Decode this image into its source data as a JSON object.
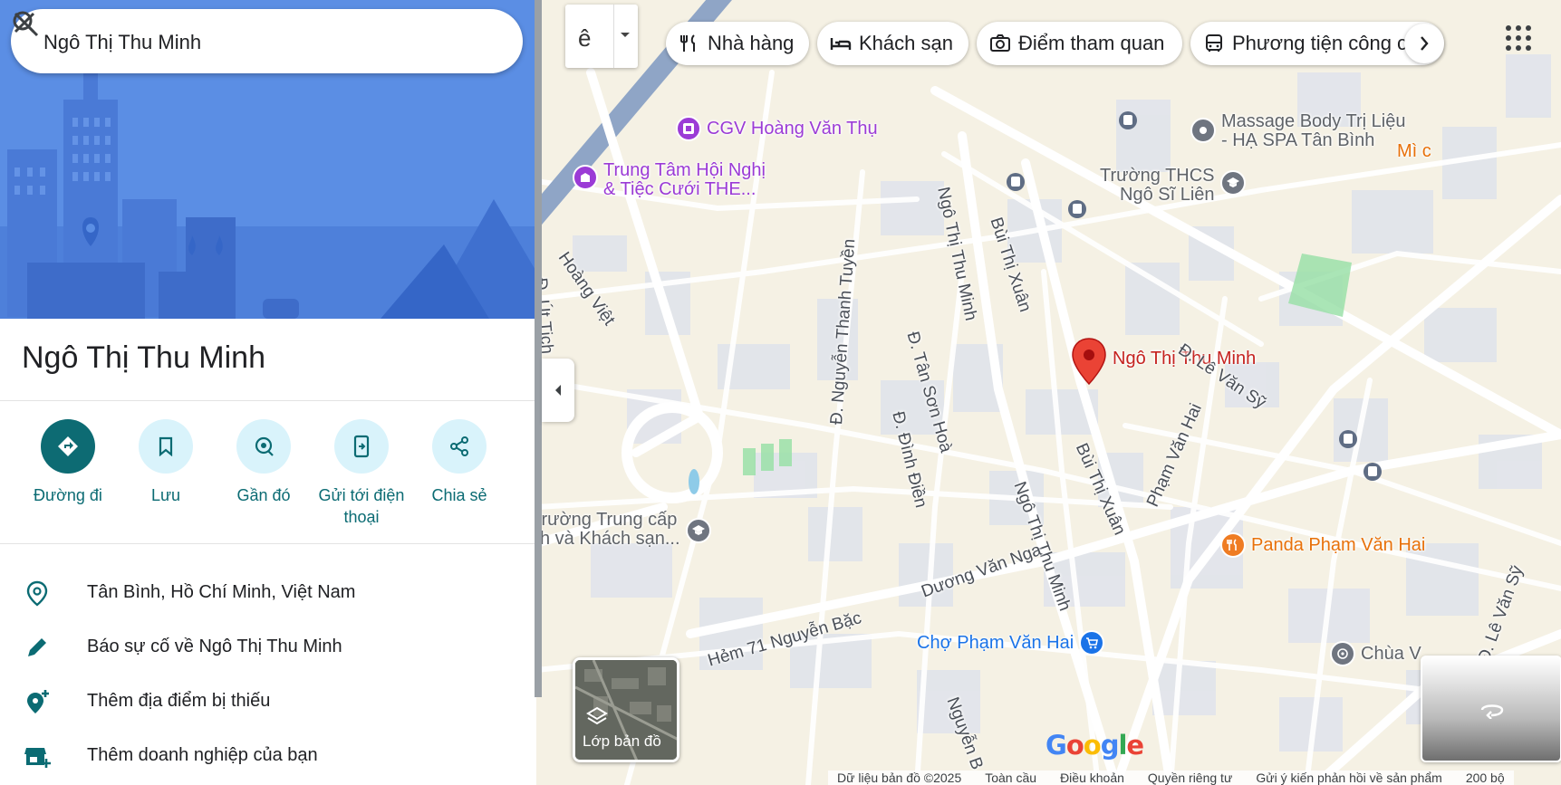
{
  "search": {
    "value": "Ngô Thị Thu Minh"
  },
  "place": {
    "title": "Ngô Thị Thu Minh"
  },
  "actions": [
    {
      "label": "Đường đi",
      "icon": "directions-icon"
    },
    {
      "label": "Lưu",
      "icon": "bookmark-icon"
    },
    {
      "label": "Gần đó",
      "icon": "nearby-icon"
    },
    {
      "label": "Gửi tới điện thoại",
      "icon": "send-to-phone-icon"
    },
    {
      "label": "Chia sẻ",
      "icon": "share-icon"
    }
  ],
  "info": {
    "address": "Tân Bình, Hồ Chí Minh, Việt Nam",
    "report": "Báo sự cố về Ngô Thị Thu Minh",
    "add_place": "Thêm địa điểm bị thiếu",
    "add_business": "Thêm doanh nghiệp của bạn"
  },
  "ime": {
    "letter": "ê"
  },
  "chips": [
    {
      "label": "Nhà hàng",
      "icon": "fork-knife-icon"
    },
    {
      "label": "Khách sạn",
      "icon": "bed-icon"
    },
    {
      "label": "Điểm tham quan",
      "icon": "camera-icon"
    },
    {
      "label": "Phương tiện công c",
      "icon": "bus-icon"
    }
  ],
  "pois": {
    "cgv": "CGV Hoàng Văn Thụ",
    "trungtam_1": "Trung Tâm Hội Nghị",
    "trungtam_2": "& Tiệc Cưới THE...",
    "massage_1": "Massage Body Trị Liệu",
    "massage_2": "- HẠ SPA Tân Bình",
    "mi": "Mì c",
    "truong_thcs_1": "Trường THCS",
    "truong_thcs_2": "Ngô Sĩ Liên",
    "pin": "Ngô Thị Thu Minh",
    "truong_tc_1": "Trường Trung cấp",
    "truong_tc_2": "ch và Khách sạn...",
    "panda": "Panda Phạm Văn Hai",
    "cho": "Chợ Phạm Văn Hai",
    "chua": "Chùa V"
  },
  "streets": {
    "hoang_viet": "Hoàng Việt",
    "ut_tich": "Đ. Út Tịch",
    "nguyen_thanh_tuyen": "Đ. Nguyễn Thanh Tuyền",
    "ngo_thi_thu_minh_top": "Ngô Thị Thu Minh",
    "bui_thi_xuan_top": "Bùi Thị Xuân",
    "tan_son_hoa": "Đ. Tân Sơn Hoà",
    "dinh_dien": "Đ. Đình Điền",
    "le_van_sy": "Đ. Lê Văn Sỹ",
    "pham_van_hai": "Phạm Văn Hai",
    "bui_thi_xuan_bottom": "Bùi Thị Xuân",
    "ngo_thi_thu_minh_bottom": "Ngô Thị Thu Minh",
    "duong_van_nga": "Dương Văn Nga",
    "hem_71": "Hẻm 71 Nguyễn Bặc",
    "nguyen_b": "Nguyễn B",
    "le_van_sy_right": "Đ. Lê Văn Sỹ"
  },
  "layers_label": "Lớp bản đồ",
  "google": [
    "G",
    "o",
    "o",
    "g",
    "l",
    "e"
  ],
  "footer": {
    "data": "Dữ liệu bản đồ ©2025",
    "global": "Toàn cầu",
    "terms": "Điều khoản",
    "privacy": "Quyền riêng tư",
    "feedback": "Gửi ý kiến phản hồi về sản phẩm",
    "scale": "200 bộ"
  },
  "colors": {
    "primary_teal": "#0d6b73",
    "pin_red": "#ea4335",
    "poi_purple": "#9b3bd6",
    "poi_orange": "#ef7c23",
    "poi_blue": "#1a73e8",
    "poi_gray": "#6f7580"
  }
}
